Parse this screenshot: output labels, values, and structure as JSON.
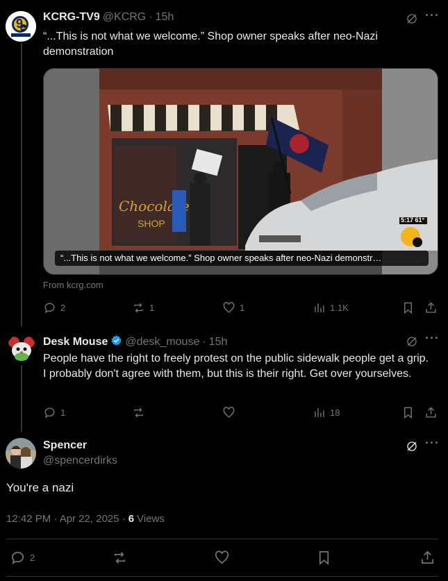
{
  "tweets": [
    {
      "name": "KCRG-TV9",
      "handle": "@KCRG",
      "time": "15h",
      "text": "“...This is not what we welcome.” Shop owner speaks after neo-Nazi demonstration",
      "card_caption": "“...This is not what we welcome.” Shop owner speaks after neo-Nazi demonstr…",
      "card_source": "From kcrg.com",
      "card_overlay_time": "5:17 61°",
      "avatar_text": "9",
      "stats": {
        "replies": "2",
        "reposts": "1",
        "likes": "1",
        "views": "1.1K"
      }
    },
    {
      "name": "Desk Mouse",
      "handle": "@desk_mouse",
      "time": "15h",
      "text": "People have the right to freely protest on the public sidewalk people get a grip. I probably don't agree with them, but this is their right. Get over yourselves.",
      "stats": {
        "replies": "1",
        "reposts": "",
        "likes": "",
        "views": "18"
      }
    }
  ],
  "main_tweet": {
    "name": "Spencer",
    "handle": "@spencerdirks",
    "text": "You're a nazi",
    "timestamp": "12:42 PM · Apr 22, 2025 ·",
    "views_count": "6",
    "views_label": "Views",
    "stats": {
      "replies": "2"
    }
  },
  "separator": "·",
  "colors": {
    "background": "#000000",
    "text": "#e7e9ea",
    "muted": "#71767b",
    "verified": "#1d9bf0",
    "border": "#2f3336"
  }
}
